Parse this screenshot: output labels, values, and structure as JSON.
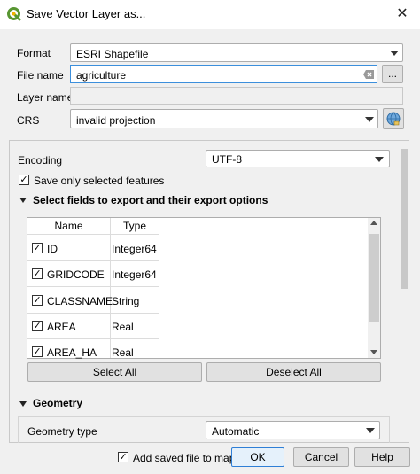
{
  "window": {
    "title": "Save Vector Layer as..."
  },
  "form": {
    "format_label": "Format",
    "format_value": "ESRI Shapefile",
    "filename_label": "File name",
    "filename_value": "agriculture",
    "browse_label": "...",
    "layername_label": "Layer name",
    "layername_value": "",
    "crs_label": "CRS",
    "crs_value": "invalid projection"
  },
  "options": {
    "encoding_label": "Encoding",
    "encoding_value": "UTF-8",
    "save_selected_label": "Save only selected features",
    "save_selected_checked": true,
    "fields_section_label": "Select fields to export and their export options",
    "fields_table": {
      "headers": [
        "Name",
        "Type"
      ],
      "rows": [
        {
          "name": "ID",
          "type": "Integer64",
          "checked": true
        },
        {
          "name": "GRIDCODE",
          "type": "Integer64",
          "checked": true
        },
        {
          "name": "CLASSNAME",
          "type": "String",
          "checked": true
        },
        {
          "name": "AREA",
          "type": "Real",
          "checked": true
        },
        {
          "name": "AREA_HA",
          "type": "Real",
          "checked": true
        }
      ]
    },
    "select_all_label": "Select All",
    "deselect_all_label": "Deselect All",
    "geometry_section_label": "Geometry",
    "geometry_type_label": "Geometry type",
    "geometry_type_value": "Automatic"
  },
  "footer": {
    "add_saved_label": "Add saved file to map",
    "add_saved_checked": true,
    "ok_label": "OK",
    "cancel_label": "Cancel",
    "help_label": "Help"
  },
  "colors": {
    "accent": "#3c8fdc",
    "qgis_green": "#589632"
  }
}
